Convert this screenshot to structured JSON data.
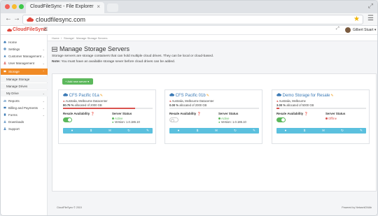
{
  "browser": {
    "tab_title": "CloudFileSync - File Explorer",
    "url": "cloudfilesync.com",
    "colors": {
      "close": "#f25f57",
      "minimize": "#f8bb2d",
      "maximize": "#3ec84a"
    }
  },
  "header": {
    "logo_text": "CloudFileSync",
    "user_name": "Gilbert Stuart ▾"
  },
  "sidebar": {
    "items": [
      {
        "label": "Home",
        "icon": "home-icon"
      },
      {
        "label": "Settings",
        "icon": "gear-icon"
      },
      {
        "label": "Customer Management",
        "icon": "customers-icon"
      },
      {
        "label": "User Management",
        "icon": "user-icon"
      },
      {
        "label": "Storage",
        "icon": "storage-icon",
        "active": true
      }
    ],
    "subitems": [
      {
        "label": "Manage Storage"
      },
      {
        "label": "Manage Drives"
      },
      {
        "label": "My Drive"
      }
    ],
    "items_after": [
      {
        "label": "Reports",
        "icon": "chart-icon"
      },
      {
        "label": "Billing and Payments",
        "icon": "billing-icon"
      },
      {
        "label": "Forms",
        "icon": "forms-icon"
      },
      {
        "label": "Downloads",
        "icon": "download-icon"
      },
      {
        "label": "Support",
        "icon": "support-icon"
      }
    ]
  },
  "breadcrumb": [
    "Home",
    "Storage",
    "Manage Storage Servers"
  ],
  "page": {
    "title": "Manage Storage Servers",
    "description": "Storage servers are storage containers that can hold multiple cloud drives. They can be local or cloud-based.",
    "note_label": "Note:",
    "note_text": "You must have an available storage sever before cloud drives can be added.",
    "add_button": "+ Add new server ▾"
  },
  "servers": [
    {
      "name": "CFS Pacific 01a",
      "location": "Australia, Melbourne Datacenter",
      "alloc_pct": "80.75 %",
      "alloc_text": "allocated of 2000 GB",
      "alloc_fraction": 0.8075,
      "resale_label": "Resale Availability",
      "resale_on": true,
      "status_label": "Server Status",
      "status": "Active",
      "status_color": "#5cb85c",
      "version": "Version: 1.0.186.10"
    },
    {
      "name": "CFS Pacific 01b",
      "location": "Australia, Melbourne Datacenter",
      "alloc_pct": "0.00 %",
      "alloc_text": "allocated of 2000 GB",
      "alloc_fraction": 0,
      "resale_label": "Resale Availability",
      "resale_on": false,
      "status_label": "Server Status",
      "status": "Active",
      "status_color": "#5cb85c",
      "version": "Version: 1.0.186.10"
    },
    {
      "name": "Demo Storage for Resale",
      "location": "Australia, Melbourne",
      "alloc_pct": "3.00 %",
      "alloc_text": "allocated of 5000 GB",
      "alloc_fraction": 0.03,
      "resale_label": "Resale Availability",
      "resale_on": true,
      "status_label": "Server Status",
      "status": "Offline",
      "status_color": "#d9534f",
      "version": ""
    }
  ],
  "card_actions": [
    "●",
    "$",
    "✉",
    "↻",
    "✎"
  ],
  "footer": {
    "left": "CloudFileSync © 2015",
    "right": "Powered by NetworkDNAb"
  }
}
